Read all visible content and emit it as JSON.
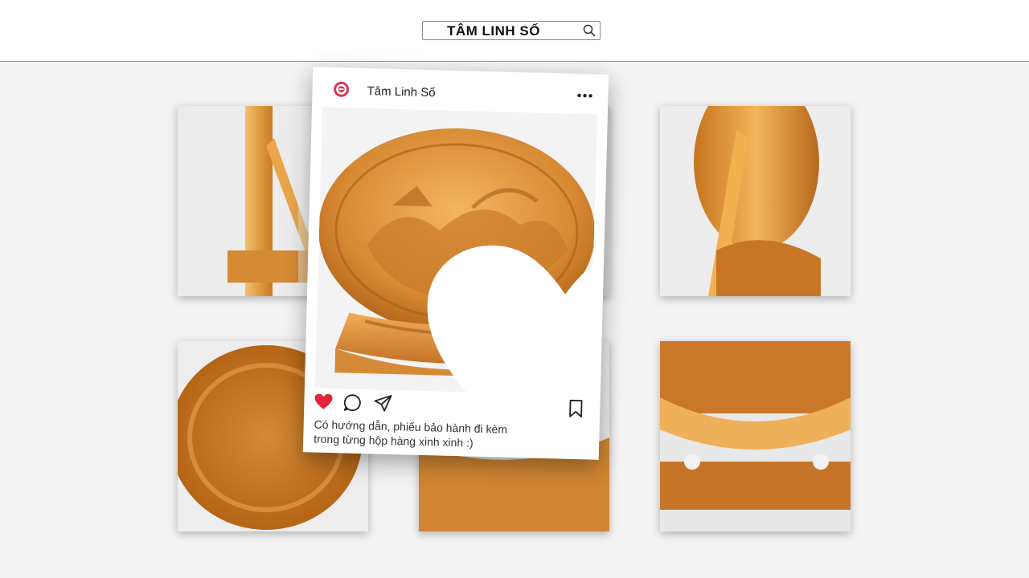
{
  "search": {
    "value": "TÂM LINH SỐ"
  },
  "post": {
    "account_name": "Tâm Linh Số",
    "caption_line_1": "Có hướng dẫn, phiếu bảo hành đi kèm",
    "caption_line_2": "trong từng hộp hàng xinh xinh :)",
    "liked": true
  },
  "colors": {
    "like_red": "#e0243a",
    "wood_light": "#f0b45a",
    "wood_dark": "#b8681c",
    "background": "#f3f3f3"
  },
  "icons": [
    "search-icon",
    "avatar-logo-icon",
    "more-options-icon",
    "heart-icon",
    "comment-icon",
    "share-icon",
    "bookmark-icon"
  ]
}
